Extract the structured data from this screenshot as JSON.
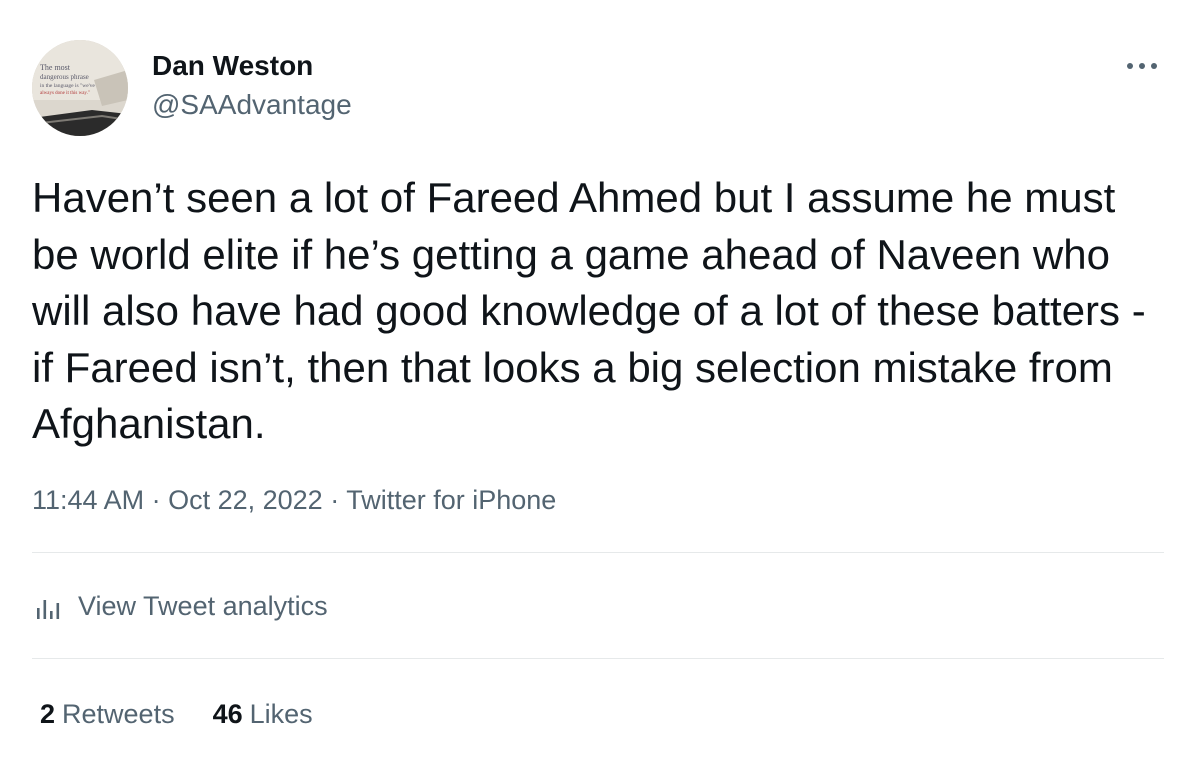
{
  "author": {
    "display_name": "Dan Weston",
    "handle": "@SAAdvantage",
    "avatar_text": [
      "The most",
      "dangerous phrase",
      "in the language is \"we've",
      "always done it this way.\""
    ]
  },
  "tweet": {
    "text": "Haven’t seen a lot of Fareed Ahmed but I assume he must be world elite if he’s getting a game ahead of Naveen who will also have had good knowledge of a lot of these batters - if Fareed isn’t, then that looks a big selection mistake from Afghanistan.",
    "time": "11:44 AM",
    "date": "Oct 22, 2022",
    "source": "Twitter for iPhone",
    "separator": " · "
  },
  "analytics": {
    "label": "View Tweet analytics",
    "icon": "bar-chart-icon"
  },
  "stats": {
    "retweets_count": "2",
    "retweets_label": "Retweets",
    "likes_count": "46",
    "likes_label": "Likes"
  },
  "icons": {
    "more": "more-options-icon"
  },
  "colors": {
    "text_primary": "#0f1419",
    "text_secondary": "#536471",
    "divider": "#e6e9ea",
    "background": "#ffffff"
  }
}
